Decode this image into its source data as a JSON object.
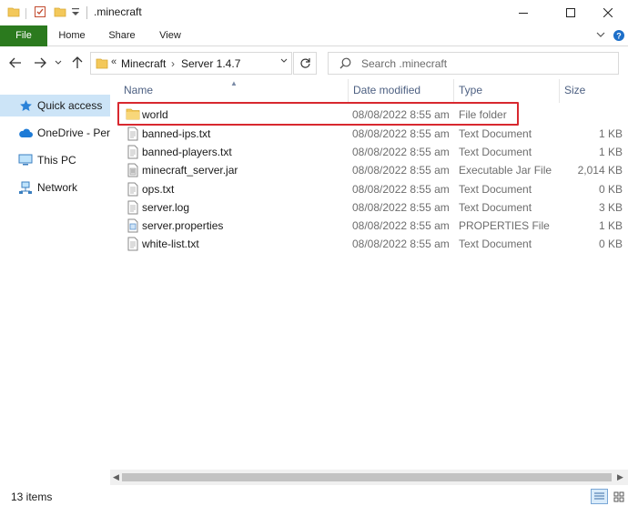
{
  "window": {
    "title": ".minecraft",
    "quick_access_icons": [
      "folder-icon",
      "properties-checkmark-icon",
      "new-folder-icon",
      "customize-dropdown-icon"
    ],
    "buttons": [
      "minimize-icon",
      "maximize-icon",
      "close-icon"
    ]
  },
  "ribbon": {
    "tabs": [
      {
        "label": "File",
        "active": true
      },
      {
        "label": "Home"
      },
      {
        "label": "Share"
      },
      {
        "label": "View"
      }
    ],
    "accent_color": "#2b7a1e"
  },
  "navigation": {
    "back_icon": "arrow-left-icon",
    "forward_icon": "arrow-right-icon",
    "recent_icon": "chevron-down-icon",
    "up_icon": "arrow-up-icon",
    "address": {
      "prefix": "«",
      "segments": [
        "Minecraft",
        "Server 1.4.7"
      ],
      "separator": "›"
    },
    "refresh_icon": "refresh-icon",
    "search_placeholder": "Search .minecraft"
  },
  "sidebar": {
    "items": [
      {
        "label": "Quick access",
        "icon": "star-icon",
        "active": true
      },
      {
        "label": "OneDrive - Pers",
        "icon": "cloud-icon"
      },
      {
        "label": "This PC",
        "icon": "computer-icon"
      },
      {
        "label": "Network",
        "icon": "network-icon"
      }
    ]
  },
  "file_list": {
    "columns": [
      "Name",
      "Date modified",
      "Type",
      "Size"
    ],
    "rows": [
      {
        "name": "world",
        "date": "08/08/2022 8:55 am",
        "type": "File folder",
        "size": "",
        "icon": "folder-icon"
      },
      {
        "name": "banned-ips.txt",
        "date": "08/08/2022 8:55 am",
        "type": "Text Document",
        "size": "1 KB",
        "icon": "text-file-icon"
      },
      {
        "name": "banned-players.txt",
        "date": "08/08/2022 8:55 am",
        "type": "Text Document",
        "size": "1 KB",
        "icon": "text-file-icon"
      },
      {
        "name": "minecraft_server.jar",
        "date": "08/08/2022 8:55 am",
        "type": "Executable Jar File",
        "size": "2,014 KB",
        "icon": "jar-file-icon"
      },
      {
        "name": "ops.txt",
        "date": "08/08/2022 8:55 am",
        "type": "Text Document",
        "size": "0 KB",
        "icon": "text-file-icon"
      },
      {
        "name": "server.log",
        "date": "08/08/2022 8:55 am",
        "type": "Text Document",
        "size": "3 KB",
        "icon": "text-file-icon"
      },
      {
        "name": "server.properties",
        "date": "08/08/2022 8:55 am",
        "type": "PROPERTIES File",
        "size": "1 KB",
        "icon": "properties-file-icon"
      },
      {
        "name": "white-list.txt",
        "date": "08/08/2022 8:55 am",
        "type": "Text Document",
        "size": "0 KB",
        "icon": "text-file-icon"
      }
    ],
    "highlighted_row": "world",
    "highlight_color": "#d8282f"
  },
  "status": {
    "item_count": "13 items",
    "view_icons": [
      "details-view-icon",
      "large-icons-view-icon"
    ]
  }
}
